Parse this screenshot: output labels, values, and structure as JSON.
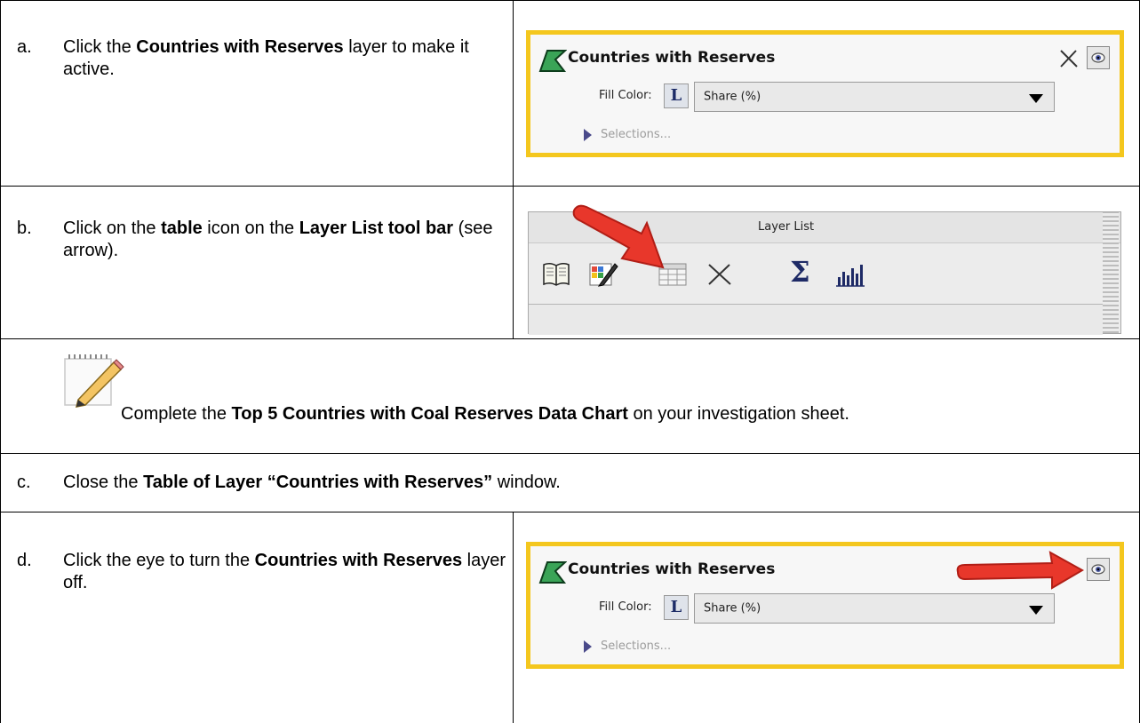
{
  "steps": {
    "a": {
      "letter": "a.",
      "pre": "Click the ",
      "bold1": "Countries with Reserves",
      "post": " layer to make it active."
    },
    "b": {
      "letter": "b.",
      "pre": "Click on the ",
      "bold1": "table",
      "mid": " icon on the ",
      "bold2": "Layer List tool bar",
      "post": " (see arrow)."
    },
    "note": {
      "pre": "Complete the ",
      "bold1": "Top 5 Countries with Coal Reserves Data Chart",
      "post": " on your investigation sheet."
    },
    "c": {
      "letter": "c.",
      "pre": "Close the ",
      "bold1": "Table of Layer “Countries with Reserves”",
      "post": " window."
    },
    "d": {
      "letter": "d.",
      "pre": "Click the eye to turn the ",
      "bold1": "Countries with Reserves",
      "post": " layer off."
    }
  },
  "layer_panel": {
    "title": "Countries with Reserves",
    "fill_label": "Fill Color:",
    "fill_button": "L",
    "fill_value": "Share (%)",
    "selections": "Selections..."
  },
  "layer_list": {
    "title": "Layer List",
    "icons": [
      "book-icon",
      "edit-icon",
      "table-icon",
      "delete-icon",
      "sigma-icon",
      "histogram-icon"
    ],
    "sigma_glyph": "Σ"
  },
  "colors": {
    "highlight": "#f4c71e",
    "arrow": "#e8372b",
    "layer_icon": "#3aa457"
  }
}
